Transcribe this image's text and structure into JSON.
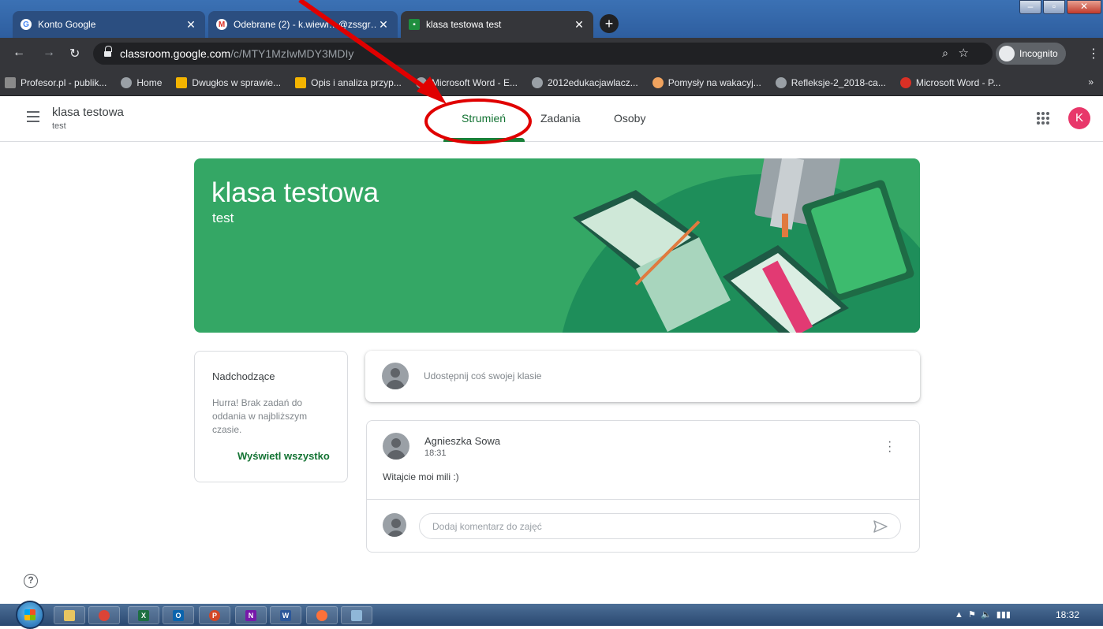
{
  "browser": {
    "tabs": [
      {
        "title": "Konto Google",
        "icon": "google-g-icon",
        "active": false
      },
      {
        "title": "Odebrane (2) - k.wiewi…@zssgr…",
        "icon": "gmail-icon",
        "active": false
      },
      {
        "title": "klasa testowa test",
        "icon": "classroom-icon",
        "active": true
      }
    ],
    "url_host": "classroom.google.com",
    "url_path": "/c/MTY1MzIwMDY3MDIy",
    "incognito_label": "Incognito",
    "bookmarks": [
      {
        "label": "Profesor.pl - publik...",
        "color": "#8a8a8a"
      },
      {
        "label": "Home",
        "color": "#9aa0a6"
      },
      {
        "label": "Dwugłos w sprawie...",
        "color": "#f4b400"
      },
      {
        "label": "Opis i analiza przyp...",
        "color": "#f4b400"
      },
      {
        "label": "Microsoft Word - E...",
        "color": "#9aa0a6"
      },
      {
        "label": "2012edukacjawlacz...",
        "color": "#9aa0a6"
      },
      {
        "label": "Pomysły na wakacyj...",
        "color": "#f0a35e"
      },
      {
        "label": "Refleksje-2_2018-ca...",
        "color": "#9aa0a6"
      },
      {
        "label": "Microsoft Word - P...",
        "color": "#d93025"
      }
    ],
    "bookmarks_more": "»"
  },
  "header": {
    "class_name": "klasa testowa",
    "class_section": "test",
    "tabs": [
      "Strumień",
      "Zadania",
      "Osoby"
    ],
    "active_tab": "Strumień",
    "avatar_letter": "K",
    "accent_color": "#188038"
  },
  "banner": {
    "title": "klasa testowa",
    "subtitle": "test",
    "color": "#34a765"
  },
  "upcoming": {
    "title": "Nadchodzące",
    "text": "Hurra! Brak zadań do oddania w najbliższym czasie.",
    "link": "Wyświetl wszystko"
  },
  "share": {
    "placeholder": "Udostępnij coś swojej klasie"
  },
  "post": {
    "author": "Agnieszka Sowa",
    "time": "18:31",
    "body": "Witajcie moi mili :)",
    "comment_placeholder": "Dodaj komentarz do zajęć"
  },
  "taskbar": {
    "apps": [
      "explorer",
      "chrome",
      "excel",
      "outlook",
      "powerpoint",
      "onenote",
      "word",
      "firefox",
      "paint"
    ],
    "clock": "18:32"
  }
}
